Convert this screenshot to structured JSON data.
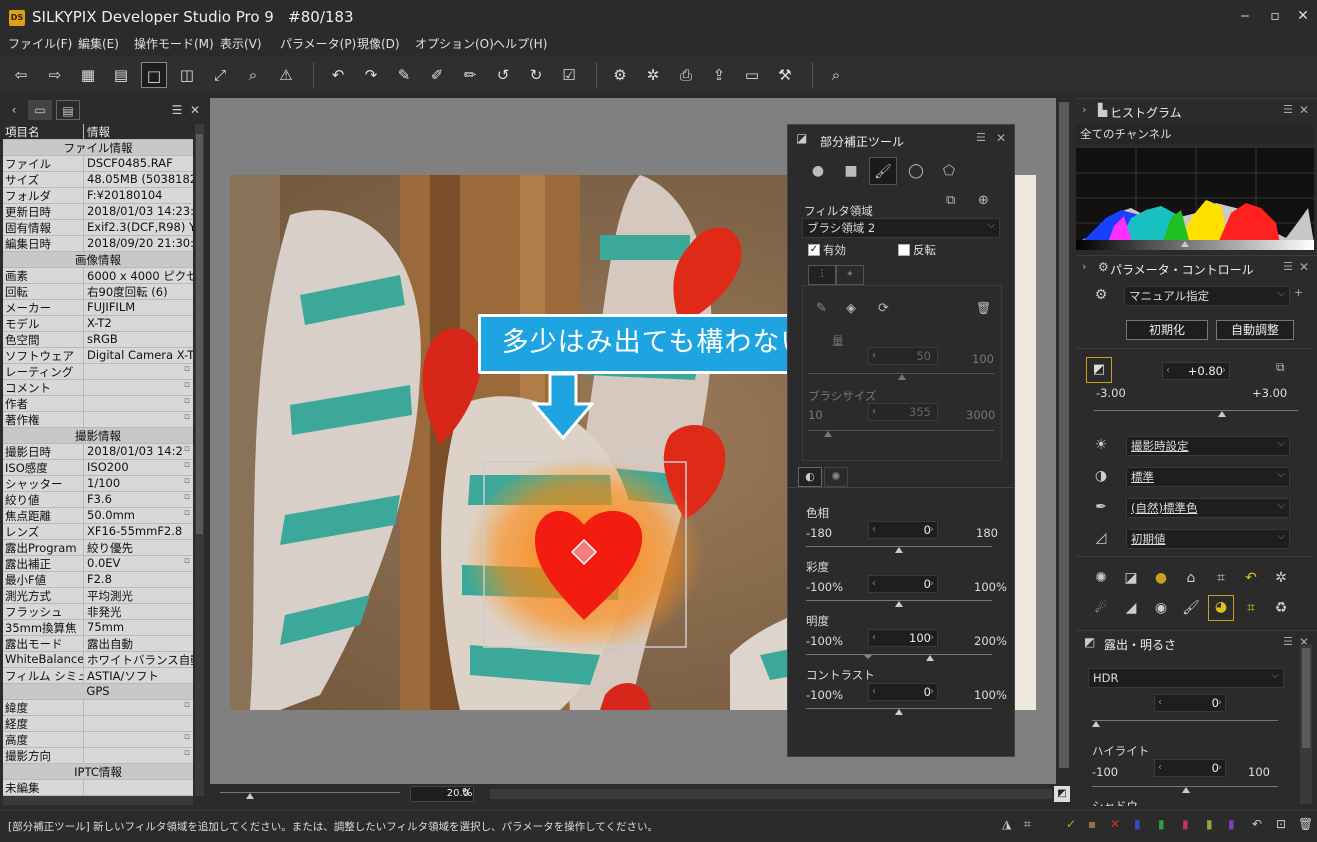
{
  "app": {
    "title": "SILKYPIX Developer Studio Pro 9",
    "counter": "#80/183",
    "logo": "DS"
  },
  "menu": [
    "ファイル(F)",
    "編集(E)",
    "操作モード(M)",
    "表示(V)",
    "パラメータ(P)",
    "現像(D)",
    "オプション(O)",
    "ヘルプ(H)"
  ],
  "info_table": {
    "col_key": "項目名",
    "col_val": "情報",
    "rows": [
      {
        "s": "ファイル情報"
      },
      {
        "k": "ファイル",
        "v": "DSCF0485.RAF"
      },
      {
        "k": "サイズ",
        "v": "48.05MB (5038182"
      },
      {
        "k": "フォルダ",
        "v": "F:¥20180104"
      },
      {
        "k": "更新日時",
        "v": "2018/01/03 14:23:"
      },
      {
        "k": "固有情報",
        "v": "Exif2.3(DCF,R98) Y"
      },
      {
        "k": "編集日時",
        "v": "2018/09/20 21:30:"
      },
      {
        "s": "画像情報"
      },
      {
        "k": "画素",
        "v": "6000 x 4000 ピクセ"
      },
      {
        "k": "回転",
        "v": "右90度回転 (6)"
      },
      {
        "k": "メーカー",
        "v": "FUJIFILM"
      },
      {
        "k": "モデル",
        "v": "X-T2"
      },
      {
        "k": "色空間",
        "v": "sRGB"
      },
      {
        "k": "ソフトウェア",
        "v": "Digital Camera X-T"
      },
      {
        "k": "レーティング",
        "v": "",
        "d": "▫"
      },
      {
        "k": "コメント",
        "v": "",
        "d": "▫"
      },
      {
        "k": "作者",
        "v": "",
        "d": "▫"
      },
      {
        "k": "著作権",
        "v": "",
        "d": "▫"
      },
      {
        "s": "撮影情報"
      },
      {
        "k": "撮影日時",
        "v": "2018/01/03 14:2",
        "d": "▫"
      },
      {
        "k": "ISO感度",
        "v": "ISO200",
        "d": "▫"
      },
      {
        "k": "シャッター",
        "v": "1/100",
        "d": "▫"
      },
      {
        "k": "絞り値",
        "v": "F3.6",
        "d": "▫"
      },
      {
        "k": "焦点距離",
        "v": "50.0mm",
        "d": "▫"
      },
      {
        "k": "レンズ",
        "v": "XF16-55mmF2.8"
      },
      {
        "k": "露出Program",
        "v": "絞り優先"
      },
      {
        "k": "露出補正",
        "v": "0.0EV",
        "d": "▫"
      },
      {
        "k": "最小F値",
        "v": "F2.8"
      },
      {
        "k": "測光方式",
        "v": "平均測光"
      },
      {
        "k": "フラッシュ",
        "v": "非発光"
      },
      {
        "k": "35mm換算焦",
        "v": "75mm"
      },
      {
        "k": "露出モード",
        "v": "露出自動"
      },
      {
        "k": "WhiteBalance",
        "v": "ホワイトバランス自動"
      },
      {
        "k": "フィルム シミュレー",
        "v": "ASTIA/ソフト"
      },
      {
        "s": "GPS"
      },
      {
        "k": "緯度",
        "v": "",
        "d": "▫"
      },
      {
        "k": "経度",
        "v": ""
      },
      {
        "k": "高度",
        "v": "",
        "d": "▫"
      },
      {
        "k": "撮影方向",
        "v": "",
        "d": "▫"
      },
      {
        "s": "IPTC情報"
      },
      {
        "k": "未編集",
        "v": ""
      }
    ]
  },
  "callout": "多少はみ出ても構わない",
  "zoom": {
    "value": "20.0",
    "unit": "%"
  },
  "parts_tool": {
    "title": "部分補正ツール",
    "filter_area_label": "フィルタ領域",
    "filter_area_value": "ブラシ領域 2",
    "enabled": "有効",
    "enabled_checked": true,
    "invert": "反転",
    "invert_checked": false,
    "amount_label": "量",
    "amount_value": "50",
    "amount_max": "100",
    "brush_label": "ブラシサイズ",
    "brush_min": "10",
    "brush_value": "355",
    "brush_max": "3000",
    "params": [
      {
        "label": "色相",
        "min": "-180",
        "value": "0",
        "max": "180",
        "pos": 0.5
      },
      {
        "label": "彩度",
        "min": "-100%",
        "value": "0",
        "max": "100%",
        "pos": 0.5
      },
      {
        "label": "明度",
        "min": "-100%",
        "value": "100",
        "max": "200%",
        "pos": 0.667
      },
      {
        "label": "コントラスト",
        "min": "-100%",
        "value": "0",
        "max": "100%",
        "pos": 0.5
      }
    ]
  },
  "histogram": {
    "title": "ヒストグラム",
    "channel": "全てのチャンネル"
  },
  "param_control": {
    "title": "パラメータ・コントロール",
    "mode": "マニュアル指定",
    "init_btn": "初期化",
    "auto_btn": "自動調整",
    "exposure_value": "+0.80",
    "exposure_min": "-3.00",
    "exposure_max": "+3.00",
    "wb": "撮影時設定",
    "tone": "標準",
    "color": "(自然)標準色",
    "sharp": "初期値"
  },
  "exposure_panel": {
    "title": "露出・明るさ",
    "hdr_label": "HDR",
    "hdr_value": "0",
    "highlight_label": "ハイライト",
    "highlight_min": "-100",
    "highlight_value": "0",
    "highlight_max": "100",
    "shadow_label": "シャドウ"
  },
  "status_text": "[部分補正ツール] 新しいフィルタ領域を追加してください。または、調整したいフィルタ領域を選択し、パラメータを操作してください。",
  "colors": {
    "accent": "#1ea4e0",
    "bg": "#2b2b2b",
    "heart": "#e8201a"
  }
}
